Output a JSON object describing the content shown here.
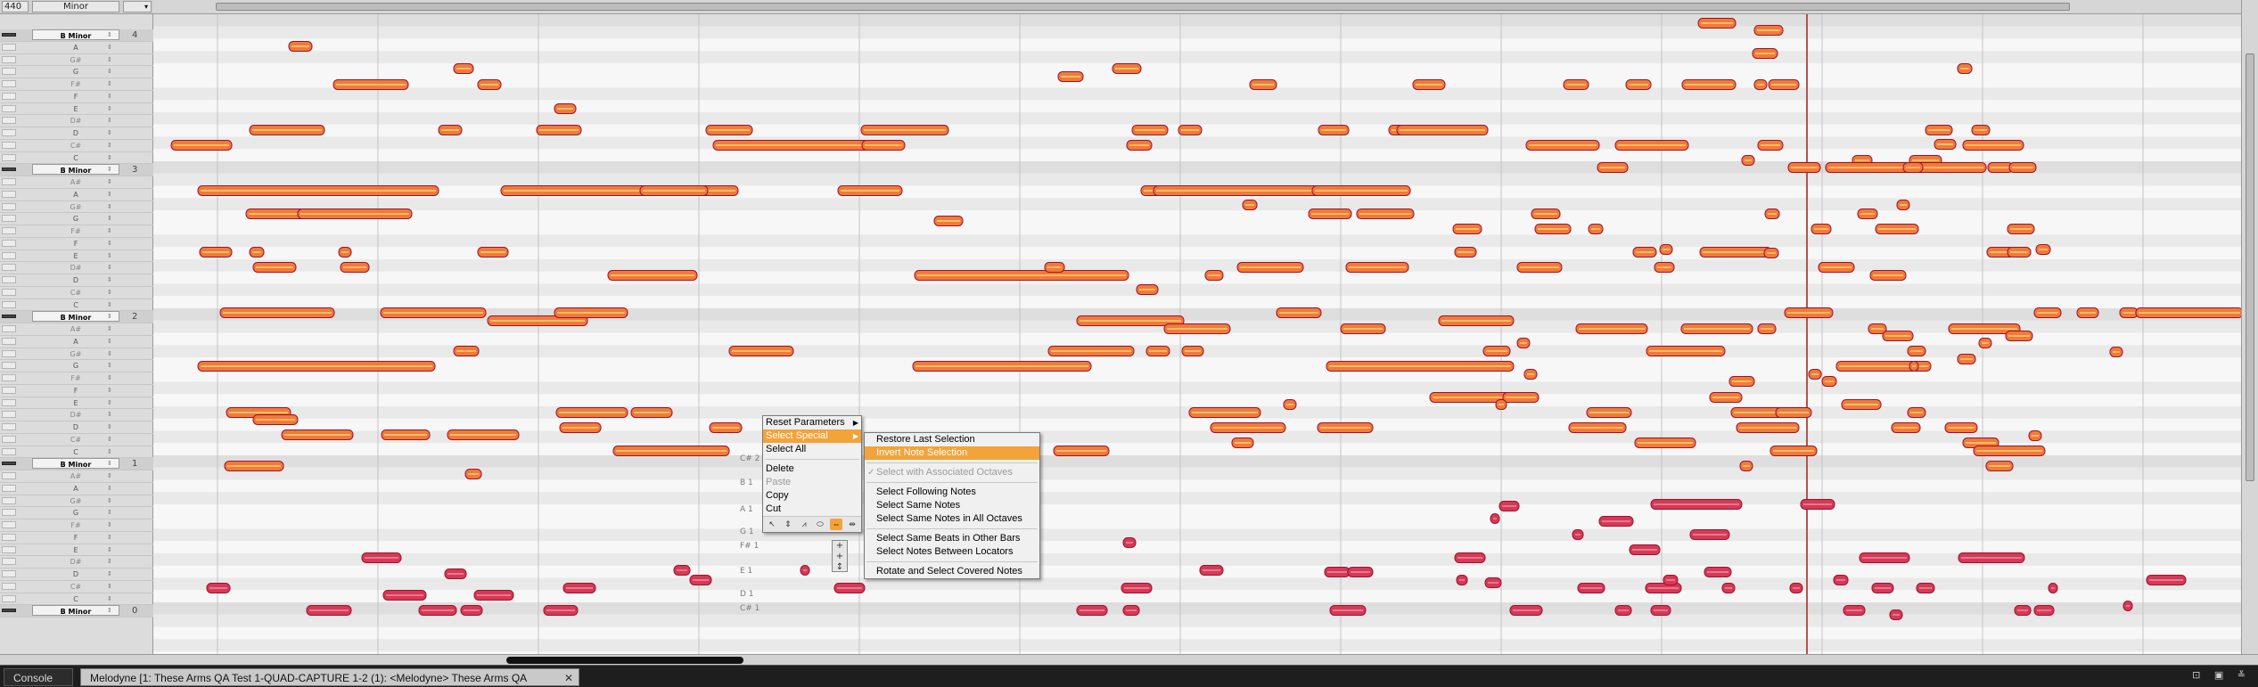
{
  "ruler": {
    "reference_hz": "440",
    "scale": "Minor",
    "scale_dropdown": "▾",
    "octave_label": "B Minor",
    "rows": [
      {
        "type": "octave",
        "bar": "4"
      },
      {
        "label": "A"
      },
      {
        "label": "G#"
      },
      {
        "label": "G"
      },
      {
        "label": "F#"
      },
      {
        "label": "F"
      },
      {
        "label": "E"
      },
      {
        "label": "D#"
      },
      {
        "label": "D"
      },
      {
        "label": "C#"
      },
      {
        "label": "C"
      },
      {
        "type": "octave",
        "bar": "3"
      },
      {
        "label": "A#"
      },
      {
        "label": "A"
      },
      {
        "label": "G#"
      },
      {
        "label": "G"
      },
      {
        "label": "F#"
      },
      {
        "label": "F"
      },
      {
        "label": "E"
      },
      {
        "label": "D#"
      },
      {
        "label": "D"
      },
      {
        "label": "C#"
      },
      {
        "label": "C"
      },
      {
        "type": "octave",
        "bar": "2"
      },
      {
        "label": "A#"
      },
      {
        "label": "A"
      },
      {
        "label": "G#"
      },
      {
        "label": "G"
      },
      {
        "label": "F#"
      },
      {
        "label": "F"
      },
      {
        "label": "E"
      },
      {
        "label": "D#"
      },
      {
        "label": "D"
      },
      {
        "label": "C#"
      },
      {
        "label": "C"
      },
      {
        "type": "octave",
        "bar": "1"
      },
      {
        "label": "A#"
      },
      {
        "label": "A"
      },
      {
        "label": "G#"
      },
      {
        "label": "G"
      },
      {
        "label": "F#"
      },
      {
        "label": "F"
      },
      {
        "label": "E"
      },
      {
        "label": "D#"
      },
      {
        "label": "D"
      },
      {
        "label": "C#"
      },
      {
        "label": "C"
      },
      {
        "type": "octave",
        "bar": "0"
      }
    ]
  },
  "grid_labels": [
    "C# 2",
    "B 1",
    "A 1",
    "G 1",
    "F# 1",
    "E 1",
    "D 1",
    "C# 1"
  ],
  "context_menu": {
    "items": [
      {
        "label": "Reset Parameters",
        "submenu": true,
        "state": "normal"
      },
      {
        "label": "Select Special",
        "submenu": true,
        "state": "highlight"
      },
      {
        "label": "Select All",
        "state": "normal"
      },
      {
        "sep": true
      },
      {
        "label": "Delete",
        "state": "normal"
      },
      {
        "label": "Paste",
        "state": "disabled"
      },
      {
        "label": "Copy",
        "state": "normal"
      },
      {
        "label": "Cut",
        "state": "normal"
      }
    ],
    "tools": [
      "↖",
      "⇕",
      "⩘",
      "⬭",
      "⇔",
      "⇹"
    ]
  },
  "submenu": {
    "items": [
      {
        "label": "Restore Last Selection",
        "state": "normal"
      },
      {
        "label": "Invert Note Selection",
        "state": "highlight"
      },
      {
        "sep": true
      },
      {
        "label": "Select with Associated Octaves",
        "state": "disabled",
        "check": "✓"
      },
      {
        "sep": true
      },
      {
        "label": "Select Following Notes",
        "state": "normal"
      },
      {
        "label": "Select Same Notes",
        "state": "normal"
      },
      {
        "label": "Select Same Notes in All Octaves",
        "state": "normal"
      },
      {
        "sep": true
      },
      {
        "label": "Select Same Beats in Other Bars",
        "state": "normal"
      },
      {
        "label": "Select Notes Between Locators",
        "state": "normal"
      },
      {
        "sep": true
      },
      {
        "label": "Rotate and Select Covered Notes",
        "state": "normal"
      }
    ]
  },
  "tabs": {
    "console": "Console",
    "melodyne": "Melodyne [1: These Arms QA Test 1-QUAD-CAPTURE 1-2 (1): <Melodyne> These Arms QA",
    "close": "✕",
    "right_controls": "⊡ ▣ ≚"
  },
  "colors": {
    "note_selected_fill": "#f07a3c",
    "note_selected_core": "#ffd36b",
    "note_unselected_fill": "#d43a56",
    "note_border": "#a0102a",
    "playhead": "#b0544c",
    "menu_highlight": "#f2a33a"
  }
}
